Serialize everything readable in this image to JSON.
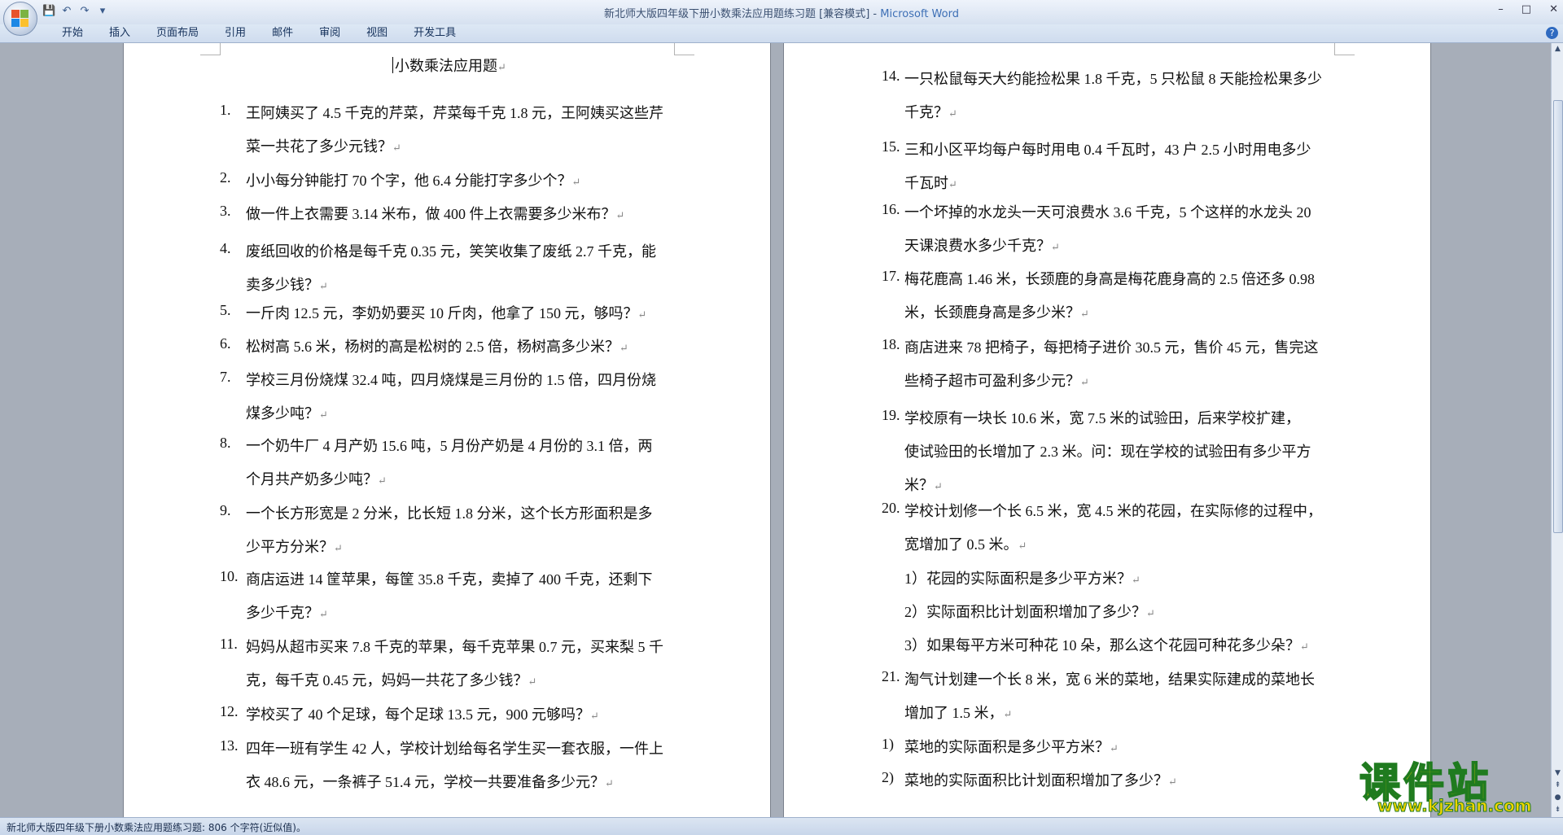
{
  "window": {
    "title": "新北师大版四年级下册小数乘法应用题练习题 [兼容模式] -",
    "app_name": "Microsoft Word",
    "controls": [
      "–",
      "□",
      "✕"
    ]
  },
  "quick_access": {
    "save": "💾",
    "undo": "↶",
    "redo": "↷",
    "more": "▾"
  },
  "ribbon": {
    "tabs": [
      "开始",
      "插入",
      "页面布局",
      "引用",
      "邮件",
      "审阅",
      "视图",
      "开发工具"
    ],
    "help": "?"
  },
  "document": {
    "title": "小数乘法应用题",
    "left_page": [
      {
        "num": "1.",
        "lines": [
          "王阿姨买了 4.5 千克的芹菜，芹菜每千克 1.8 元，王阿姨买这些芹",
          "菜一共花了多少元钱？"
        ]
      },
      {
        "num": "2.",
        "lines": [
          "小小每分钟能打 70 个字，他 6.4 分能打字多少个？"
        ]
      },
      {
        "num": "3.",
        "lines": [
          "做一件上衣需要 3.14 米布，做 400 件上衣需要多少米布？"
        ]
      },
      {
        "num": "4.",
        "lines": [
          "废纸回收的价格是每千克 0.35 元，笑笑收集了废纸 2.7 千克，能",
          "卖多少钱？"
        ]
      },
      {
        "num": "5.",
        "lines": [
          "一斤肉 12.5 元，李奶奶要买 10 斤肉，他拿了 150 元，够吗？"
        ]
      },
      {
        "num": "6.",
        "lines": [
          "松树高 5.6 米，杨树的高是松树的 2.5 倍，杨树高多少米？"
        ]
      },
      {
        "num": "7.",
        "lines": [
          "学校三月份烧煤 32.4 吨，四月烧煤是三月份的 1.5 倍，四月份烧",
          "煤多少吨？"
        ]
      },
      {
        "num": "8.",
        "lines": [
          "一个奶牛厂 4 月产奶 15.6 吨，5 月份产奶是 4 月份的 3.1 倍，两",
          "个月共产奶多少吨？"
        ]
      },
      {
        "num": "9.",
        "lines": [
          "一个长方形宽是 2 分米，比长短 1.8 分米，这个长方形面积是多",
          "少平方分米？"
        ]
      },
      {
        "num": "10.",
        "lines": [
          "商店运进 14 筐苹果，每筐 35.8 千克，卖掉了 400 千克，还剩下",
          "多少千克？"
        ]
      },
      {
        "num": "11.",
        "lines": [
          "妈妈从超市买来 7.8 千克的苹果，每千克苹果 0.7 元，买来梨 5 千",
          "克，每千克 0.45 元，妈妈一共花了多少钱？"
        ]
      },
      {
        "num": "12.",
        "lines": [
          "学校买了 40 个足球，每个足球 13.5 元，900 元够吗？"
        ]
      },
      {
        "num": "13.",
        "lines": [
          "四年一班有学生 42 人，学校计划给每名学生买一套衣服，一件上",
          "衣 48.6 元，一条裤子 51.4 元，学校一共要准备多少元？"
        ]
      }
    ],
    "right_page": [
      {
        "num": "14.",
        "lines": [
          "一只松鼠每天大约能捡松果 1.8 千克，5 只松鼠 8 天能捡松果多少",
          "千克？"
        ]
      },
      {
        "num": "15.",
        "lines": [
          "三和小区平均每户每时用电 0.4 千瓦时，43 户 2.5 小时用电多少",
          "千瓦时"
        ]
      },
      {
        "num": "16.",
        "lines": [
          "一个坏掉的水龙头一天可浪费水 3.6 千克，5 个这样的水龙头 20",
          "天课浪费水多少千克？"
        ]
      },
      {
        "num": "17.",
        "lines": [
          "梅花鹿高 1.46 米，长颈鹿的身高是梅花鹿身高的 2.5 倍还多 0.98",
          "米，长颈鹿身高是多少米？"
        ]
      },
      {
        "num": "18.",
        "lines": [
          "商店进来 78 把椅子，每把椅子进价 30.5 元，售价 45 元，售完这",
          "些椅子超市可盈利多少元？"
        ]
      },
      {
        "num": "19.",
        "lines": [
          " 学校原有一块长 10.6 米，宽 7.5 米的试验田，后来学校扩建，",
          "使试验田的长增加了 2.3 米。问：现在学校的试验田有多少平方",
          "米？"
        ]
      },
      {
        "num": "20.",
        "lines": [
          "学校计划修一个长 6.5 米，宽 4.5 米的花园，在实际修的过程中，",
          "宽增加了 0.5 米。"
        ]
      },
      {
        "num": "",
        "lines": [
          "1）花园的实际面积是多少平方米？"
        ]
      },
      {
        "num": "",
        "lines": [
          "2）实际面积比计划面积增加了多少？"
        ]
      },
      {
        "num": "",
        "lines": [
          "3）如果每平方米可种花 10 朵，那么这个花园可种花多少朵？"
        ]
      },
      {
        "num": "21.",
        "lines": [
          "淘气计划建一个长 8 米，宽 6 米的菜地，结果实际建成的菜地长",
          "增加了 1.5 米，"
        ]
      },
      {
        "num": "1)",
        "lines": [
          "菜地的实际面积是多少平方米？"
        ]
      },
      {
        "num": "2)",
        "lines": [
          "菜地的实际面积比计划面积增加了多少？"
        ]
      }
    ]
  },
  "status_bar": {
    "text": "新北师大版四年级下册小数乘法应用题练习题: 806 个字符(近似值)。"
  },
  "watermark": {
    "brand": "课件站",
    "url": "www.kjzhan.com"
  },
  "colors": {
    "title_bar": "#dce6f3",
    "ribbon": "#cfdcee",
    "workspace": "#a7aeb9",
    "page": "#ffffff",
    "watermark_fill": "#f2d400",
    "watermark_stroke": "#1f7b1f"
  }
}
